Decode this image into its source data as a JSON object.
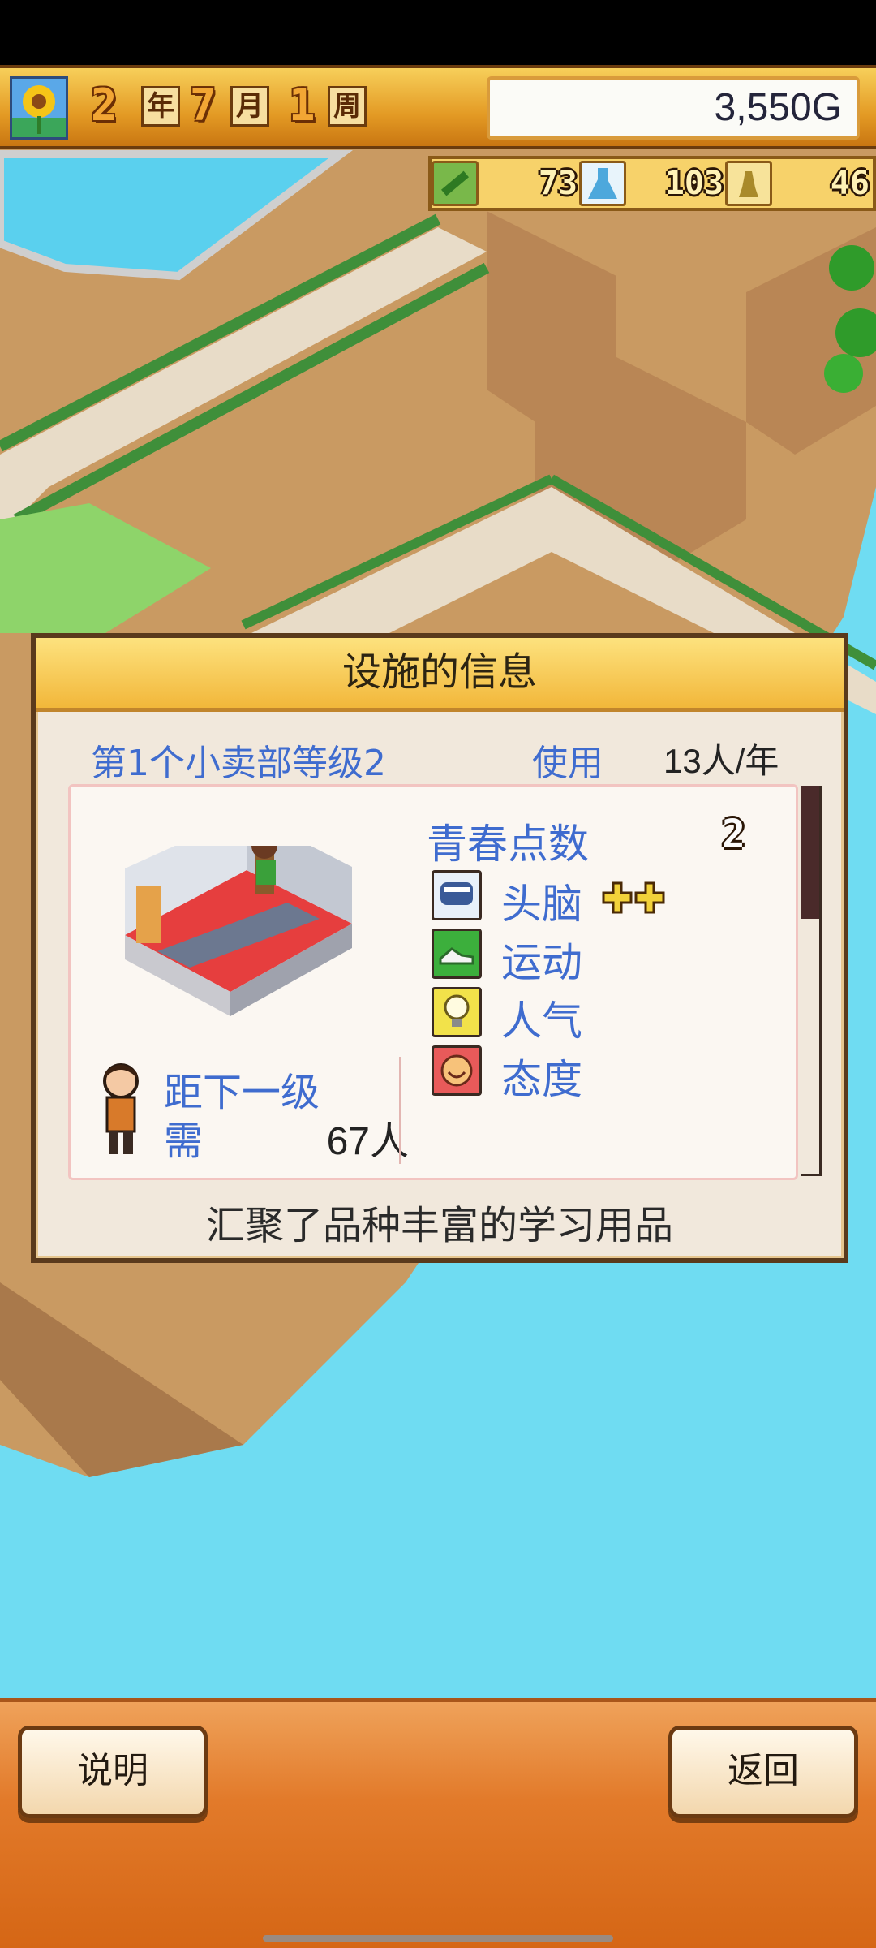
{
  "header": {
    "year": "2",
    "year_unit": "年",
    "month": "7",
    "month_unit": "月",
    "week": "1",
    "week_unit": "周",
    "money": "3,550G"
  },
  "stats": [
    {
      "icon": "pencil-icon",
      "value": "73"
    },
    {
      "icon": "flask-icon",
      "value": "103"
    },
    {
      "icon": "trophy-icon",
      "value": "46"
    }
  ],
  "panel": {
    "title": "设施的信息",
    "facility": "第1个小卖部等级2",
    "usage_label": "使用",
    "usage_value": "13人/年",
    "next_level_label": "距下一级",
    "need_label": "需",
    "need_value": "67人",
    "youth_points_label": "青春点数",
    "youth_points_value": "2",
    "attributes": [
      {
        "icon": "brain-icon",
        "label": "头脑",
        "bonus": "++"
      },
      {
        "icon": "sneaker-icon",
        "label": "运动",
        "bonus": ""
      },
      {
        "icon": "lightbulb-icon",
        "label": "人气",
        "bonus": ""
      },
      {
        "icon": "smile-face-icon",
        "label": "态度",
        "bonus": ""
      }
    ],
    "description": "汇聚了品种丰富的学习用品"
  },
  "buttons": {
    "help": "说明",
    "back": "返回"
  }
}
